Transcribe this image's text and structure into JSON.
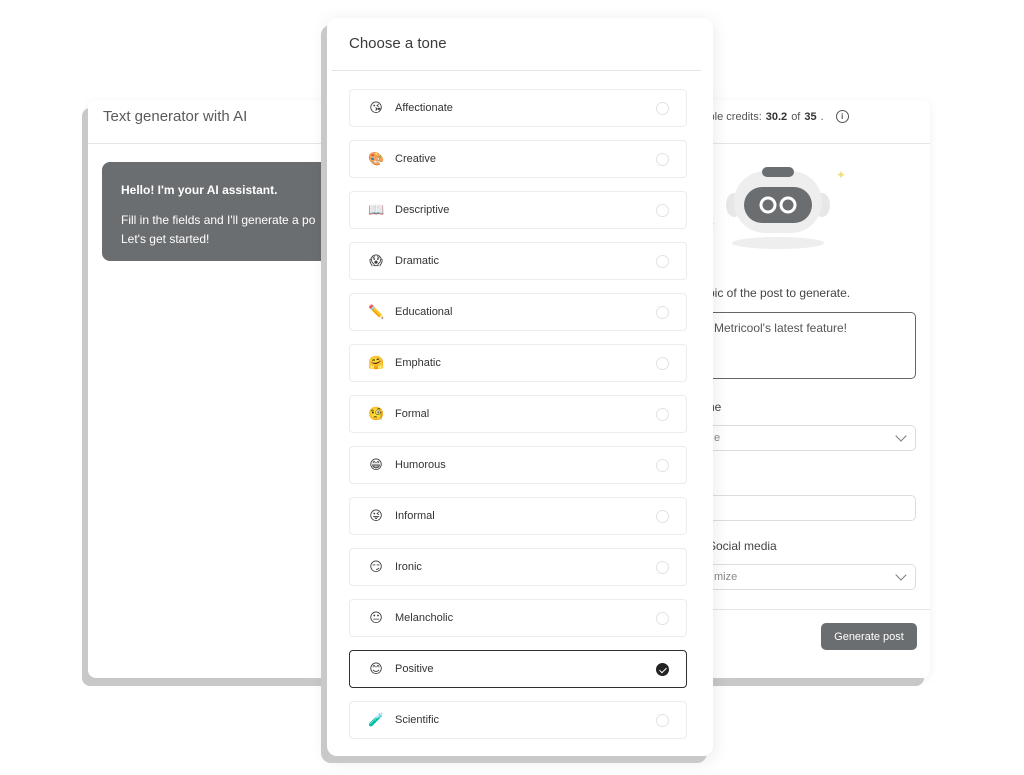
{
  "background_panel": {
    "title": "Text generator with AI",
    "credits": {
      "prefix": "lable credits: ",
      "used": "30.2",
      "of": " of ",
      "total": "35",
      "suffix": "."
    },
    "assistant": {
      "greeting": "Hello! I'm your AI assistant.",
      "line1": "Fill in the fields and I'll generate a po",
      "line2": "Let's get started!"
    },
    "topic_label": "pic of the post to generate.",
    "topic_value": "Metricool's latest feature!",
    "tone_label": "ne",
    "tone_value": "e",
    "social_label": "Social media",
    "social_value": "mize",
    "generate_label": "Generate post"
  },
  "modal": {
    "title": "Choose a tone",
    "tones": [
      {
        "emoji": "😘",
        "label": "Affectionate",
        "selected": false
      },
      {
        "emoji": "🎨",
        "label": "Creative",
        "selected": false
      },
      {
        "emoji": "📖",
        "label": "Descriptive",
        "selected": false
      },
      {
        "emoji": "😱",
        "label": "Dramatic",
        "selected": false
      },
      {
        "emoji": "✏️",
        "label": "Educational",
        "selected": false
      },
      {
        "emoji": "🤗",
        "label": "Emphatic",
        "selected": false
      },
      {
        "emoji": "🧐",
        "label": "Formal",
        "selected": false
      },
      {
        "emoji": "😁",
        "label": "Humorous",
        "selected": false
      },
      {
        "emoji": "😜",
        "label": "Informal",
        "selected": false
      },
      {
        "emoji": "😏",
        "label": "Ironic",
        "selected": false
      },
      {
        "emoji": "😐",
        "label": "Melancholic",
        "selected": false
      },
      {
        "emoji": "😊",
        "label": "Positive",
        "selected": true
      },
      {
        "emoji": "🧪",
        "label": "Scientific",
        "selected": false
      }
    ]
  },
  "colors": {
    "accent_dark": "#6b6e70",
    "selected_border": "#2f2f2f"
  }
}
